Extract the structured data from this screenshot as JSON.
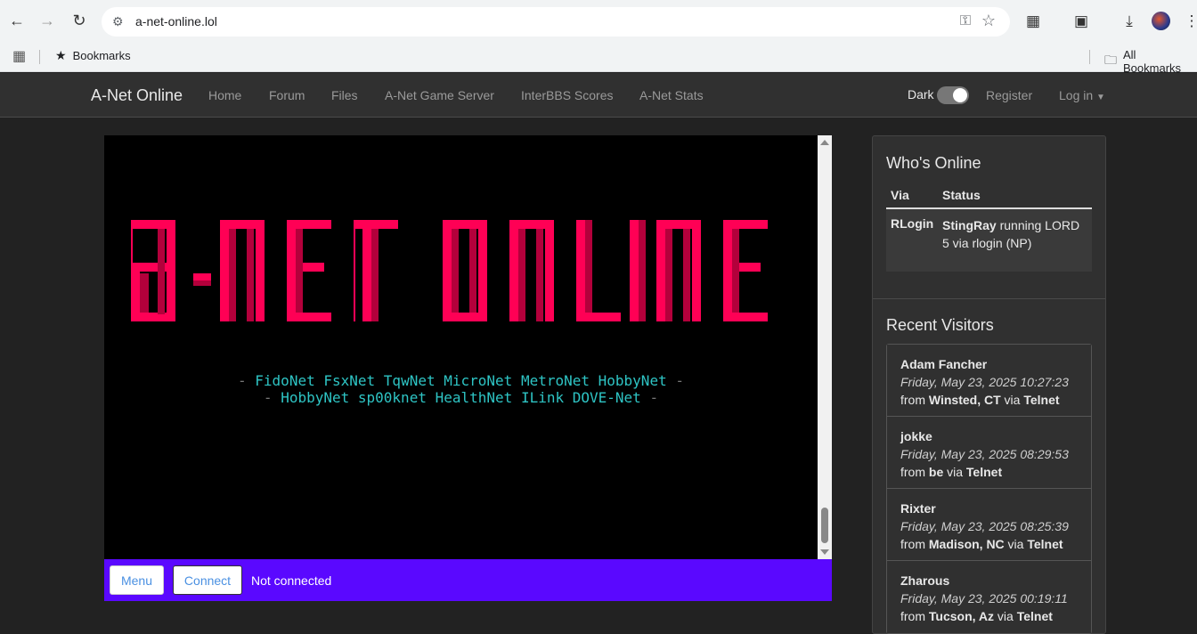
{
  "browser": {
    "url": "a-net-online.lol",
    "bookmarks_label": "Bookmarks",
    "all_bookmarks_label": "All Bookmarks"
  },
  "site": {
    "brand": "A-Net Online",
    "nav": [
      "Home",
      "Forum",
      "Files",
      "A-Net Game Server",
      "InterBBS Scores",
      "A-Net Stats"
    ],
    "dark_label": "Dark",
    "register": "Register",
    "login": "Log in"
  },
  "terminal": {
    "logo_color": "#ff0055",
    "logo_shadow": "#b3003b",
    "networks_line1": [
      "FidoNet",
      "FsxNet",
      "TqwNet",
      "MicroNet",
      "MetroNet",
      "HobbyNet"
    ],
    "networks_line2": [
      "HobbyNet",
      "sp00knet",
      "HealthNet",
      "ILink",
      "DOVE-Net"
    ],
    "menu_button": "Menu",
    "connect_button": "Connect",
    "status": "Not connected",
    "bar_color": "#5a08ff"
  },
  "whos_online": {
    "title": "Who's Online",
    "col_via": "Via",
    "col_status": "Status",
    "rows": [
      {
        "via": "RLogin",
        "user": "StingRay",
        "status": "StingRay running LORD 5 via rlogin (NP)"
      }
    ]
  },
  "recent_visitors": {
    "title": "Recent Visitors",
    "items": [
      {
        "name": "Adam Fancher",
        "time": "Friday, May 23, 2025 10:27:23",
        "from": "Winsted, CT",
        "via": "Telnet"
      },
      {
        "name": "jokke",
        "time": "Friday, May 23, 2025 08:29:53",
        "from": "be",
        "via": "Telnet"
      },
      {
        "name": "Rixter",
        "time": "Friday, May 23, 2025 08:25:39",
        "from": "Madison, NC",
        "via": "Telnet"
      },
      {
        "name": "Zharous",
        "time": "Friday, May 23, 2025 00:19:11",
        "from": "Tucson, Az",
        "via": "Telnet"
      }
    ]
  }
}
